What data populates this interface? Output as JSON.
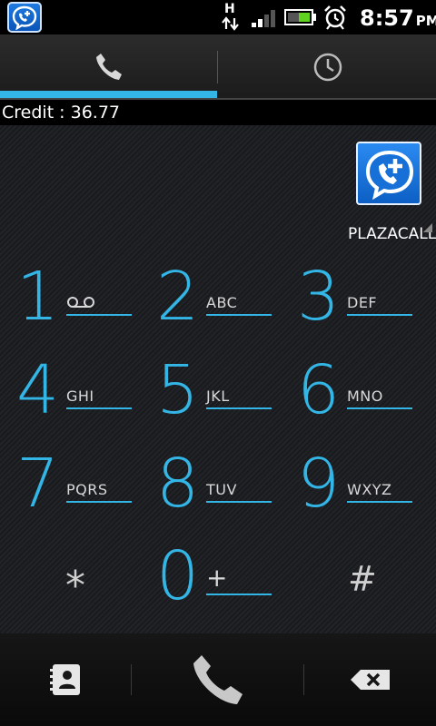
{
  "status_bar": {
    "time": "8:57",
    "ampm": "PM",
    "network": "H",
    "icons": [
      "app-icon",
      "data-arrows-icon",
      "signal-icon",
      "battery-icon",
      "alarm-icon"
    ]
  },
  "tabs": [
    {
      "icon": "phone-icon",
      "selected": true
    },
    {
      "icon": "clock-icon",
      "selected": false
    }
  ],
  "credit": {
    "label": "Credit : 36.77"
  },
  "provider": {
    "label": "PLAZACALL",
    "icon": "plazacall-logo-icon"
  },
  "keypad": [
    {
      "digit": "1",
      "letters": "",
      "icon": "voicemail-icon"
    },
    {
      "digit": "2",
      "letters": "ABC"
    },
    {
      "digit": "3",
      "letters": "DEF"
    },
    {
      "digit": "4",
      "letters": "GHI"
    },
    {
      "digit": "5",
      "letters": "JKL"
    },
    {
      "digit": "6",
      "letters": "MNO"
    },
    {
      "digit": "7",
      "letters": "PQRS"
    },
    {
      "digit": "8",
      "letters": "TUV"
    },
    {
      "digit": "9",
      "letters": "WXYZ"
    },
    {
      "digit": "*",
      "letters": ""
    },
    {
      "digit": "0",
      "letters": "+"
    },
    {
      "digit": "#",
      "letters": ""
    }
  ],
  "bottom_bar": {
    "icons": [
      "contacts-icon",
      "call-icon",
      "backspace-icon"
    ]
  },
  "colors": {
    "accent": "#33b5e5",
    "background": "#1a1c1f",
    "brand": "#1e7be0"
  }
}
